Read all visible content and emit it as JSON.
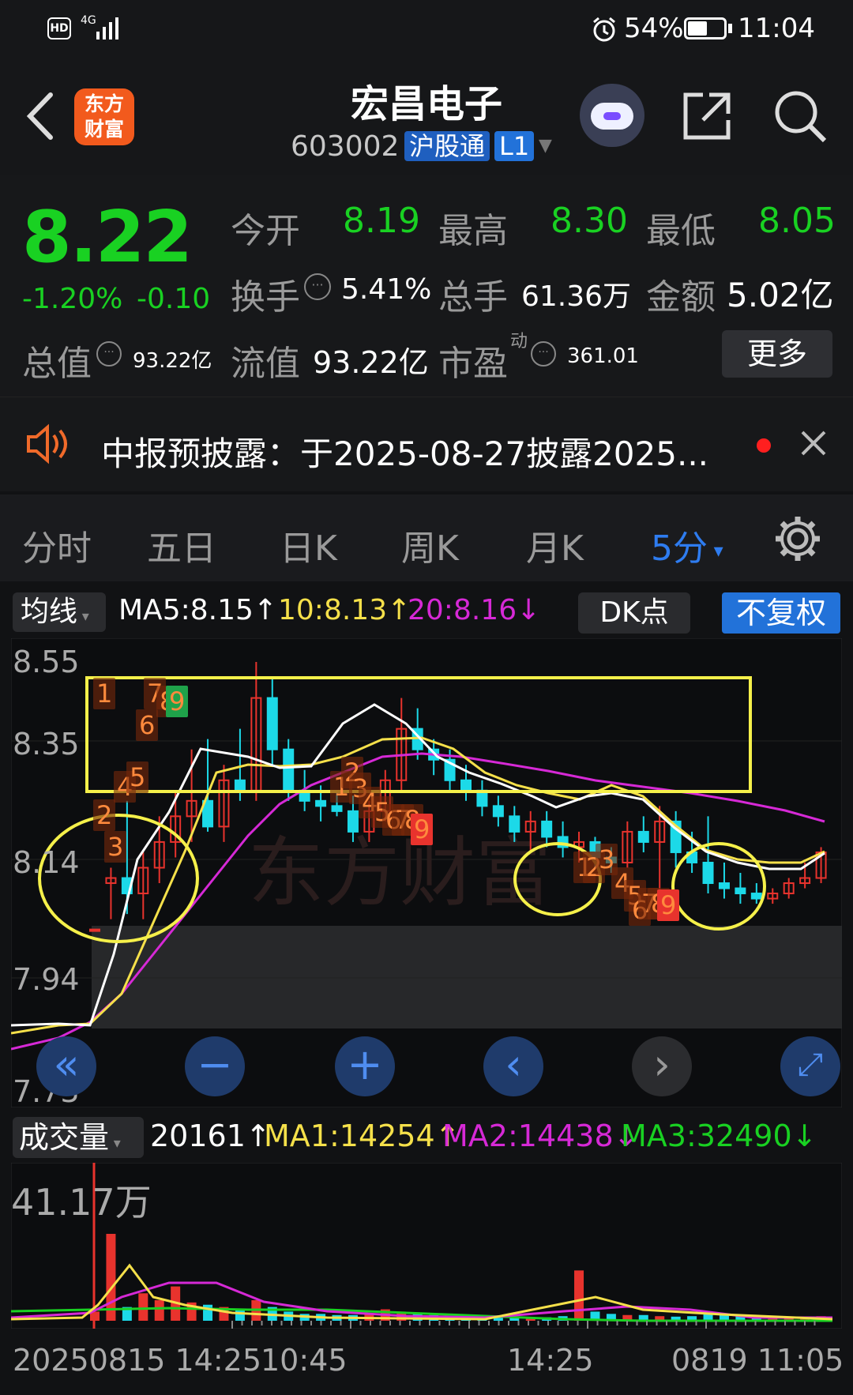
{
  "status_bar": {
    "hd": "HD",
    "network": "4G",
    "battery": "54%",
    "time": "11:04"
  },
  "header": {
    "logo_line1": "东方",
    "logo_line2": "财富",
    "title": "宏昌电子",
    "code": "603002",
    "badge_hgt": "沪股通",
    "badge_level": "L1"
  },
  "quote": {
    "price": "8.22",
    "change_pct": "-1.20%",
    "change": "-0.10",
    "open_label": "今开",
    "open": "8.19",
    "high_label": "最高",
    "high": "8.30",
    "low_label": "最低",
    "low": "8.05",
    "turnover_label": "换手",
    "turnover": "5.41%",
    "volume_label": "总手",
    "volume": "61.36万",
    "amount_label": "金额",
    "amount": "5.02亿",
    "mktcap_label": "总值",
    "mktcap": "93.22亿",
    "float_label": "流值",
    "float": "93.22亿",
    "pe_label": "市盈",
    "pe_sup": "动",
    "pe": "361.01",
    "more": "更多"
  },
  "notice": {
    "text": "中报预披露：于2025-08-27披露2025..."
  },
  "tabs": [
    "分时",
    "五日",
    "日K",
    "周K",
    "月K",
    "5分"
  ],
  "active_tab": "5分",
  "chart_header": {
    "ma_btn": "均线",
    "ma5": "MA5:8.15↑",
    "ma10": "10:8.13↑",
    "ma20": "20:8.16↓",
    "dk": "DK点",
    "fq": "不复权"
  },
  "colors": {
    "up": "#e8332d",
    "down": "#1cd9e8",
    "green": "#19d122",
    "ma5": "#ffffff",
    "ma10": "#f5e04a",
    "ma20": "#d629d6",
    "highlight": "#f5f04a",
    "blue": "#2e7cf0"
  },
  "price_axis": [
    "8.55",
    "8.35",
    "8.14",
    "7.94",
    "7.73"
  ],
  "volume_header": {
    "label": "成交量",
    "vol": "20161↑",
    "ma1": "MA1:14254↑",
    "ma2": "MA2:14438↓",
    "ma3": "MA3:32490↓"
  },
  "volume_axis": {
    "max": "41.17万"
  },
  "time_axis": [
    "20250815 14:25",
    "10:45",
    "14:25",
    "0819 11:05"
  ],
  "td_numbers_left": [
    "1",
    "2",
    "3",
    "4",
    "5",
    "6",
    "7",
    "8",
    "9"
  ],
  "td_numbers_mid": [
    "1",
    "2",
    "3",
    "4",
    "5",
    "6",
    "7",
    "8",
    "9"
  ],
  "td_numbers_right": [
    "1",
    "2",
    "3",
    "4",
    "5",
    "6",
    "7",
    "8",
    "9"
  ],
  "watermark": "东方财富",
  "chart_data": {
    "type": "candlestick",
    "ylim": [
      7.73,
      8.55
    ],
    "candles": [
      [
        8.03,
        8.03,
        8.03,
        8.03
      ],
      [
        8.12,
        8.15,
        8.05,
        8.13
      ],
      [
        8.13,
        8.28,
        8.06,
        8.1
      ],
      [
        8.1,
        8.18,
        8.05,
        8.15
      ],
      [
        8.15,
        8.25,
        8.12,
        8.2
      ],
      [
        8.2,
        8.3,
        8.17,
        8.25
      ],
      [
        8.25,
        8.38,
        8.2,
        8.28
      ],
      [
        8.28,
        8.4,
        8.22,
        8.23
      ],
      [
        8.23,
        8.35,
        8.2,
        8.32
      ],
      [
        8.32,
        8.42,
        8.28,
        8.3
      ],
      [
        8.3,
        8.55,
        8.28,
        8.48
      ],
      [
        8.48,
        8.52,
        8.35,
        8.38
      ],
      [
        8.38,
        8.4,
        8.28,
        8.3
      ],
      [
        8.3,
        8.34,
        8.26,
        8.28
      ],
      [
        8.28,
        8.31,
        8.24,
        8.27
      ],
      [
        8.27,
        8.3,
        8.25,
        8.26
      ],
      [
        8.26,
        8.29,
        8.2,
        8.22
      ],
      [
        8.22,
        8.28,
        8.2,
        8.26
      ],
      [
        8.26,
        8.34,
        8.24,
        8.32
      ],
      [
        8.32,
        8.48,
        8.3,
        8.42
      ],
      [
        8.42,
        8.46,
        8.36,
        8.38
      ],
      [
        8.38,
        8.4,
        8.33,
        8.36
      ],
      [
        8.36,
        8.38,
        8.3,
        8.32
      ],
      [
        8.32,
        8.35,
        8.28,
        8.3
      ],
      [
        8.3,
        8.32,
        8.25,
        8.27
      ],
      [
        8.27,
        8.29,
        8.23,
        8.25
      ],
      [
        8.25,
        8.27,
        8.2,
        8.22
      ],
      [
        8.22,
        8.26,
        8.18,
        8.24
      ],
      [
        8.24,
        8.26,
        8.19,
        8.21
      ],
      [
        8.21,
        8.24,
        8.17,
        8.19
      ],
      [
        8.19,
        8.22,
        8.16,
        8.2
      ],
      [
        8.2,
        8.21,
        8.15,
        8.17
      ],
      [
        8.17,
        8.19,
        8.14,
        8.16
      ],
      [
        8.16,
        8.24,
        8.15,
        8.22
      ],
      [
        8.22,
        8.25,
        8.18,
        8.2
      ],
      [
        8.2,
        8.27,
        8.05,
        8.24
      ],
      [
        8.24,
        8.26,
        8.15,
        8.18
      ],
      [
        8.18,
        8.22,
        8.14,
        8.16
      ],
      [
        8.16,
        8.25,
        8.1,
        8.12
      ],
      [
        8.12,
        8.16,
        8.09,
        8.11
      ],
      [
        8.11,
        8.14,
        8.08,
        8.1
      ],
      [
        8.1,
        8.12,
        8.08,
        8.09
      ],
      [
        8.09,
        8.11,
        8.08,
        8.1
      ],
      [
        8.1,
        8.13,
        8.09,
        8.12
      ],
      [
        8.12,
        8.16,
        8.11,
        8.13
      ],
      [
        8.13,
        8.19,
        8.12,
        8.18
      ]
    ],
    "ma5": [
      8.03,
      8.05,
      8.12,
      8.2,
      8.24,
      8.28,
      8.3,
      8.29,
      8.29,
      8.28,
      8.28,
      8.27,
      8.28,
      8.32,
      8.38,
      8.36,
      8.33,
      8.3,
      8.27,
      8.25,
      8.23,
      8.21,
      8.22,
      8.21,
      8.18,
      8.15,
      8.12,
      8.1,
      8.1,
      8.11,
      8.15
    ],
    "volume": [
      4000,
      38000,
      6000,
      12000,
      9000,
      15000,
      8000,
      7000,
      6000,
      5000,
      9000,
      6000,
      4000,
      3000,
      3000,
      2500,
      2500,
      3000,
      5000,
      4000,
      3000,
      2500,
      2000,
      2000,
      2000,
      1800,
      1800,
      1600,
      1500,
      2000,
      22000,
      4000,
      3000,
      2500,
      2500,
      2000,
      1800,
      2000,
      3000,
      2500,
      2200,
      1800,
      1500,
      1500,
      1800,
      2000
    ]
  }
}
